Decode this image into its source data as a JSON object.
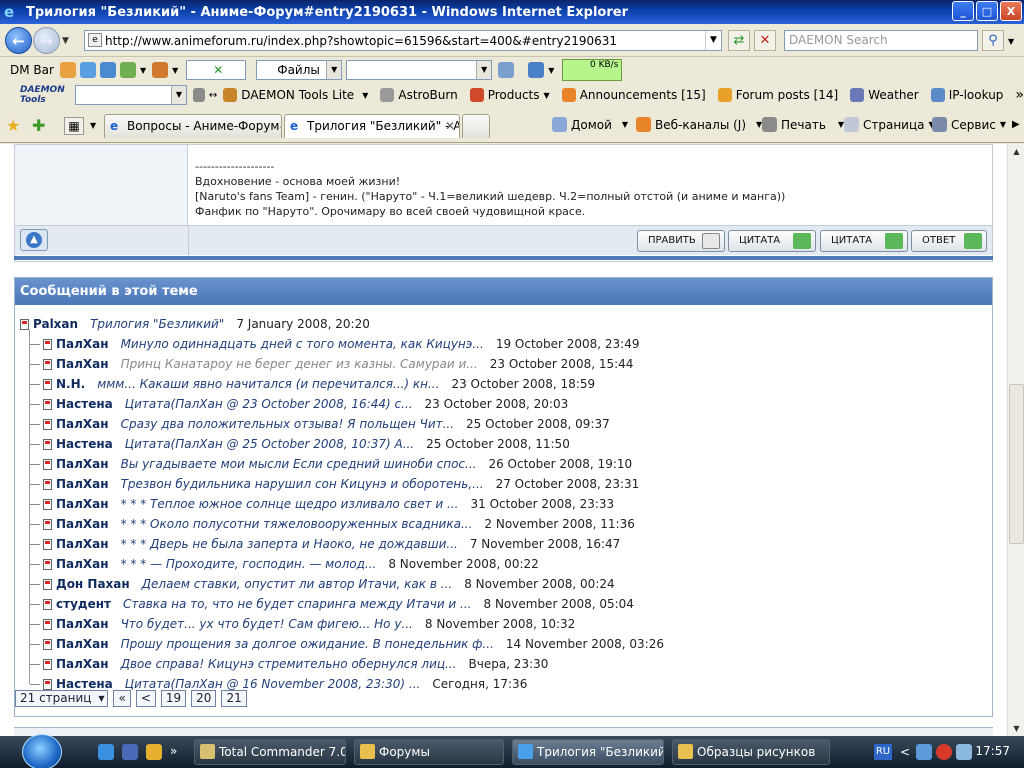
{
  "window": {
    "title": "Трилогия \"Безликий\" - Аниме-Форум#entry2190631 - Windows Internet Explorer",
    "minimize": "_",
    "maximize": "□",
    "close": "X"
  },
  "address": {
    "url": "http://www.animeforum.ru/index.php?showtopic=61596&start=400&#entry2190631",
    "search_placeholder": "DAEMON Search"
  },
  "toolbar1": {
    "dm_bar": "DM Bar",
    "files_select": "Файлы",
    "speed": "0 KB/s"
  },
  "toolbar2": {
    "daemon_logo": "DAEMON Tools",
    "items": [
      {
        "label": "DAEMON Tools Lite",
        "icon": "daemon-icon",
        "color": "#c8862a"
      },
      {
        "label": "AstroBurn",
        "icon": "astroburn-icon",
        "color": "#9a9a9a"
      },
      {
        "label": "Products",
        "icon": "products-icon",
        "color": "#d04a2a"
      },
      {
        "label": "Announcements [15]",
        "icon": "rss-icon",
        "color": "#e8842a"
      },
      {
        "label": "Forum posts [14]",
        "icon": "forum-icon",
        "color": "#e8a02a"
      },
      {
        "label": "Weather",
        "icon": "weather-icon",
        "color": "#6a7ab8"
      },
      {
        "label": "IP-lookup",
        "icon": "ip-icon",
        "color": "#5a8ac8"
      }
    ],
    "more": "»"
  },
  "tabs": [
    {
      "label": "Вопросы - Аниме-Форум#en...",
      "active": false
    },
    {
      "label": "Трилогия \"Безликий\" - А...",
      "active": true
    }
  ],
  "commands": {
    "home": "Домой",
    "feeds": "Веб-каналы (J)",
    "print": "Печать",
    "page": "Страница",
    "tools": "Сервис"
  },
  "post": {
    "signature": [
      "--------------------",
      "Вдохновение - основа моей жизни!",
      "[Naruto's fans Team] - генин. (\"Наруто\" - Ч.1=великий шедевр. Ч.2=полный отстой (и аниме и манга))",
      "Фанфик по \"Наруто\". Орочимару во всей своей чудовищной красе."
    ],
    "buttons": {
      "edit": "ПРАВИТЬ",
      "quote1": "ЦИТАТА",
      "quote2": "ЦИТАТА",
      "reply": "ОТВЕТ"
    }
  },
  "topic": {
    "header": "Сообщений в этой теме",
    "root": {
      "author": "Palxan",
      "snippet": "Трилогия \"Безликий\"",
      "date": "7 January 2008, 20:20"
    },
    "items": [
      {
        "author": "ПалХан",
        "snippet": "Минуло одиннадцать дней с того момента, как Кицунэ...",
        "date": "19 October 2008, 23:49",
        "grey": false
      },
      {
        "author": "ПалХан",
        "snippet": "Принц Канатароу не берег денег из казны. Самураи и...",
        "date": "23 October 2008, 15:44",
        "grey": true
      },
      {
        "author": "N.H.",
        "snippet": "ммм... Какаши явно начитался (и перечитался...) кн...",
        "date": "23 October 2008, 18:59",
        "grey": false
      },
      {
        "author": "Настена",
        "snippet": "Цитата(ПалХан @ 23 October 2008, 16:44) с...",
        "date": "23 October 2008, 20:03",
        "grey": false
      },
      {
        "author": "ПалХан",
        "snippet": "Сразу два положительных отзыва! Я польщен Чит...",
        "date": "25 October 2008, 09:37",
        "grey": false
      },
      {
        "author": "Настена",
        "snippet": "Цитата(ПалХан @ 25 October 2008, 10:37) А...",
        "date": "25 October 2008, 11:50",
        "grey": false
      },
      {
        "author": "ПалХан",
        "snippet": "Вы угадываете мои мысли Если средний шиноби спос...",
        "date": "26 October 2008, 19:10",
        "grey": false
      },
      {
        "author": "ПалХан",
        "snippet": "Трезвон будильника нарушил сон Кицунэ и оборотень,...",
        "date": "27 October 2008, 23:31",
        "grey": false
      },
      {
        "author": "ПалХан",
        "snippet": "* * * Теплое южное солнце щедро изливало свет и ...",
        "date": "31 October 2008, 23:33",
        "grey": false
      },
      {
        "author": "ПалХан",
        "snippet": "* * * Около полусотни тяжеловооруженных всадника...",
        "date": "2 November 2008, 11:36",
        "grey": false
      },
      {
        "author": "ПалХан",
        "snippet": "* * * Дверь не была заперта и Наоко, не дождавши...",
        "date": "7 November 2008, 16:47",
        "grey": false
      },
      {
        "author": "ПалХан",
        "snippet": "* * * — Проходите, господин. — молод...",
        "date": "8 November 2008, 00:22",
        "grey": false
      },
      {
        "author": "Дон Пахан",
        "snippet": "Делаем ставки, опустит ли автор Итачи, как в ...",
        "date": "8 November 2008, 00:24",
        "grey": false
      },
      {
        "author": "студент",
        "snippet": "Ставка на то, что не будет спаринга между Итачи и ...",
        "date": "8 November 2008, 05:04",
        "grey": false
      },
      {
        "author": "ПалХан",
        "snippet": "Что будет... ух что будет! Сам фигею... Но у...",
        "date": "8 November 2008, 10:32",
        "grey": false
      },
      {
        "author": "ПалХан",
        "snippet": "Прошу прощения за долгое ожидание. В понедельник ф...",
        "date": "14 November 2008, 03:26",
        "grey": false
      },
      {
        "author": "ПалХан",
        "snippet": "Двое справа! Кицунэ стремительно обернулся лиц...",
        "date": "Вчера, 23:30",
        "grey": false
      },
      {
        "author": "Настена",
        "snippet": "Цитата(ПалХан @ 16 November 2008, 23:30) ...",
        "date": "Сегодня, 17:36",
        "grey": false
      }
    ],
    "pager": {
      "pages_select": "21 страниц",
      "first": "«",
      "prev": "<",
      "pages": [
        "19",
        "20",
        "21"
      ]
    }
  },
  "taskbar": {
    "buttons": [
      {
        "label": "Total Commander 7.0...",
        "active": false,
        "color": "#d8c070"
      },
      {
        "label": "Форумы",
        "active": false,
        "color": "#e8c050"
      },
      {
        "label": "Трилогия \"Безликий\"...",
        "active": true,
        "color": "#4aa0e8"
      },
      {
        "label": "Образцы рисунков",
        "active": false,
        "color": "#e8c050"
      }
    ],
    "lang": "RU",
    "arrow": "<",
    "clock": "17:57"
  },
  "colors": {
    "accent": "#4a76b8",
    "link": "#0f2a5e"
  }
}
